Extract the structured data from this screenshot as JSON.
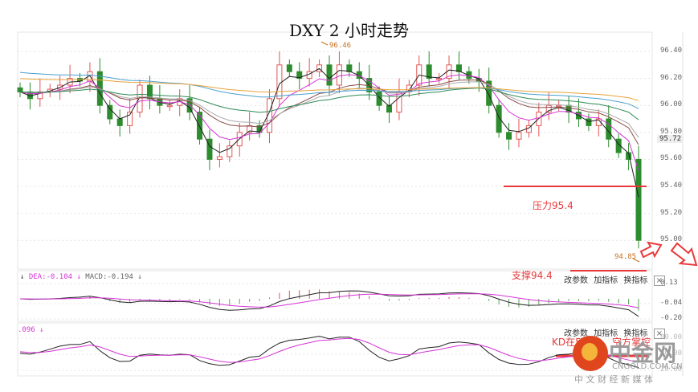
{
  "chart_data": {
    "type": "candlestick",
    "title": "DXY 2 小时走势",
    "price_axis": {
      "ticks": [
        "96.40",
        "96.20",
        "96.00",
        "95.80",
        "95.60",
        "95.40",
        "95.20",
        "95.00"
      ],
      "ylim": [
        94.75,
        96.55
      ]
    },
    "current_price": "95.72",
    "high_label": "96.46",
    "low_label": "94.85",
    "closes": [
      96.1,
      96.05,
      96.1,
      96.12,
      96.15,
      96.2,
      96.18,
      96.25,
      96.0,
      95.9,
      95.85,
      95.95,
      96.15,
      96.05,
      96.0,
      96.0,
      96.05,
      95.95,
      95.75,
      95.6,
      95.62,
      95.7,
      95.8,
      95.85,
      95.8,
      96.05,
      96.3,
      96.25,
      96.2,
      96.25,
      96.3,
      96.15,
      96.3,
      96.25,
      96.2,
      96.1,
      96.0,
      95.95,
      96.1,
      96.15,
      96.3,
      96.2,
      96.2,
      96.3,
      96.25,
      96.2,
      96.18,
      96.0,
      95.8,
      95.75,
      95.8,
      95.85,
      95.95,
      96.0,
      96.0,
      95.95,
      95.9,
      95.85,
      95.9,
      95.75,
      95.65,
      95.6,
      95.0
    ],
    "ma_colors": [
      "#222222",
      "#d633d6",
      "#8b4a4a",
      "#aaaaaa",
      "#2e8b57",
      "#4a9fd0",
      "#e8a23a"
    ],
    "annotations": {
      "resistance": "压力95.4",
      "support": "支撑94.4",
      "kd_note_left": "KD在5",
      "kd_note_right": "空方掌控",
      "resistance_value": 95.4
    },
    "macd": {
      "legend": {
        "dea": "DEA:-0.104",
        "macd": "MACD:-0.194",
        "arrow": "↓"
      },
      "ticks": [
        "0.13",
        "-0.04",
        "-0.20"
      ]
    },
    "kd": {
      "legend": ".096",
      "arrow": "↓",
      "ticks": [
        "80.00",
        "50.00",
        "20.00"
      ]
    }
  },
  "panel_tools": {
    "edit_params": "改参数",
    "add_indicator": "加指标",
    "switch_indicator": "换指标",
    "close": "×"
  },
  "watermark": {
    "brand": "中金网",
    "domain": "CNGOLD.COM.CN",
    "slogan": "中 文 财 经 新 媒 体"
  },
  "colors": {
    "up": "#e25555",
    "down": "#2d8c2d",
    "accent": "#e8383a"
  }
}
